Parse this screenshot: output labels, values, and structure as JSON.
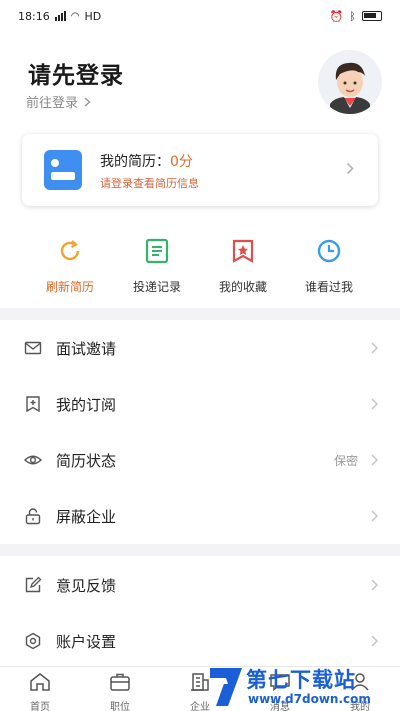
{
  "status_bar": {
    "time": "18:16",
    "network": "HD"
  },
  "header": {
    "title": "请先登录",
    "login_link": "前往登录"
  },
  "resume_card": {
    "title": "我的简历：",
    "score": "0分",
    "subtitle": "请登录查看简历信息"
  },
  "quick_actions": [
    {
      "label": "刷新简历",
      "icon": "refresh-icon",
      "active": true
    },
    {
      "label": "投递记录",
      "icon": "document-list-icon",
      "active": false
    },
    {
      "label": "我的收藏",
      "icon": "bookmark-star-icon",
      "active": false
    },
    {
      "label": "谁看过我",
      "icon": "clock-icon",
      "active": false
    }
  ],
  "menu": {
    "interview": {
      "label": "面试邀请",
      "icon": "mail-icon"
    },
    "subscription": {
      "label": "我的订阅",
      "icon": "bookmark-plus-icon"
    },
    "resume_status": {
      "label": "简历状态",
      "value": "保密",
      "icon": "eye-icon"
    },
    "block_company": {
      "label": "屏蔽企业",
      "icon": "lock-icon"
    },
    "feedback": {
      "label": "意见反馈",
      "icon": "edit-icon"
    },
    "account_settings": {
      "label": "账户设置",
      "icon": "gear-icon"
    }
  },
  "bottom_nav": [
    {
      "label": "首页",
      "icon": "home-icon"
    },
    {
      "label": "职位",
      "icon": "briefcase-icon"
    },
    {
      "label": "企业",
      "icon": "building-icon"
    },
    {
      "label": "消息",
      "icon": "message-icon"
    },
    {
      "label": "我的",
      "icon": "user-icon"
    }
  ],
  "watermark": {
    "text": "第七下载站",
    "url": "www.d7down.com"
  },
  "colors": {
    "accent": "#e06a2a",
    "resume_icon": "#3f8ff0",
    "watermark": "#1a5fd8"
  }
}
